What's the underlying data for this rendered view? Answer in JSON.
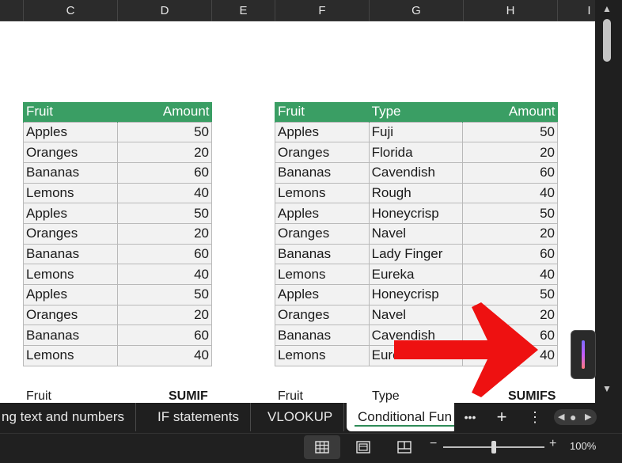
{
  "columns": [
    "C",
    "D",
    "E",
    "F",
    "G",
    "H",
    "I"
  ],
  "table1": {
    "headers": [
      "Fruit",
      "Amount"
    ],
    "rows": [
      [
        "Apples",
        "50"
      ],
      [
        "Oranges",
        "20"
      ],
      [
        "Bananas",
        "60"
      ],
      [
        "Lemons",
        "40"
      ],
      [
        "Apples",
        "50"
      ],
      [
        "Oranges",
        "20"
      ],
      [
        "Bananas",
        "60"
      ],
      [
        "Lemons",
        "40"
      ],
      [
        "Apples",
        "50"
      ],
      [
        "Oranges",
        "20"
      ],
      [
        "Bananas",
        "60"
      ],
      [
        "Lemons",
        "40"
      ]
    ]
  },
  "table2": {
    "headers": [
      "Fruit",
      "Type",
      "Amount"
    ],
    "rows": [
      [
        "Apples",
        "Fuji",
        "50"
      ],
      [
        "Oranges",
        "Florida",
        "20"
      ],
      [
        "Bananas",
        "Cavendish",
        "60"
      ],
      [
        "Lemons",
        "Rough",
        "40"
      ],
      [
        "Apples",
        "Honeycrisp",
        "50"
      ],
      [
        "Oranges",
        "Navel",
        "20"
      ],
      [
        "Bananas",
        "Lady Finger",
        "60"
      ],
      [
        "Lemons",
        "Eureka",
        "40"
      ],
      [
        "Apples",
        "Honeycrisp",
        "50"
      ],
      [
        "Oranges",
        "Navel",
        "20"
      ],
      [
        "Bananas",
        "Cavendish",
        "60"
      ],
      [
        "Lemons",
        "Eureka",
        "40"
      ]
    ]
  },
  "below_labels": {
    "fruit1": "Fruit",
    "sumif": "SUMIF",
    "fruit2": "Fruit",
    "type": "Type",
    "sumifs": "SUMIFS"
  },
  "tabs": [
    {
      "label": "ng text and numbers",
      "active": false
    },
    {
      "label": "IF statements",
      "active": false
    },
    {
      "label": "VLOOKUP",
      "active": false
    },
    {
      "label": "Conditional Fun",
      "active": true
    }
  ],
  "tab_controls": {
    "more": "•••",
    "add": "+",
    "menu": "⋮"
  },
  "status": {
    "zoom_level": "100%",
    "zoom_minus": "−",
    "zoom_plus": "+"
  },
  "colors": {
    "header_green": "#3a9e64",
    "annotation_red": "#ee1111"
  },
  "icons": [
    "normal-view-icon",
    "page-layout-icon",
    "page-break-icon",
    "copilot-icon",
    "red-arrow-annotation"
  ]
}
